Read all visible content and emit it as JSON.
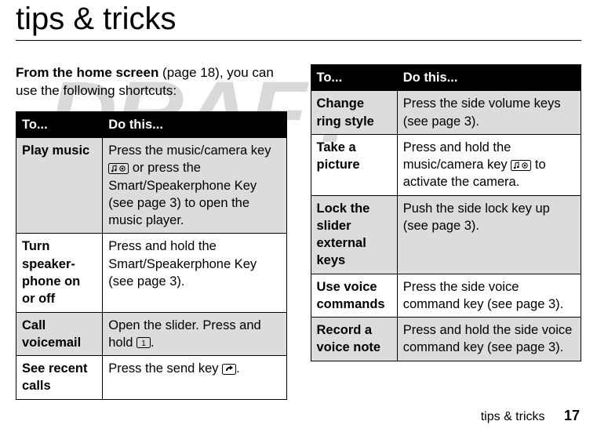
{
  "watermark": "DRAFT",
  "heading": "tips & tricks",
  "intro_bold": "From the home screen",
  "intro_rest": " (page 18), you can use the following shortcuts:",
  "col_headers": {
    "to": "To...",
    "do": "Do this..."
  },
  "table_left": [
    {
      "to": "Play music",
      "do_before": "Press the music/camera key ",
      "icon": "music-camera-icon",
      "do_after": " or press the Smart/Speakerphone Key (see page 3) to open the music player.",
      "shaded": true
    },
    {
      "to": "Turn speaker-phone on or off",
      "do_before": "Press and hold the Smart/Speakerphone Key (see page 3).",
      "icon": null,
      "do_after": "",
      "shaded": false
    },
    {
      "to": "Call voicemail",
      "do_before": "Open the slider. Press and hold ",
      "icon": "key-1-icon",
      "do_after": ".",
      "shaded": true
    },
    {
      "to": "See recent calls",
      "do_before": "Press the send key ",
      "icon": "send-key-icon",
      "do_after": ".",
      "shaded": false
    }
  ],
  "table_right": [
    {
      "to": "Change ring style",
      "do_before": "Press the side volume keys (see page 3).",
      "icon": null,
      "do_after": "",
      "shaded": true
    },
    {
      "to": "Take a picture",
      "do_before": "Press and hold the music/camera key ",
      "icon": "music-camera-icon",
      "do_after": "  to activate the camera.",
      "shaded": false
    },
    {
      "to": "Lock the slider external keys",
      "do_before": "Push the side lock key up (see page 3).",
      "icon": null,
      "do_after": "",
      "shaded": true
    },
    {
      "to": "Use voice commands",
      "do_before": "Press the side voice command key (see page 3).",
      "icon": null,
      "do_after": "",
      "shaded": false
    },
    {
      "to": "Record a voice note",
      "do_before": "Press and hold the side voice command key (see page 3).",
      "icon": null,
      "do_after": "",
      "shaded": true
    }
  ],
  "footer": {
    "label": "tips & tricks",
    "page": "17"
  }
}
